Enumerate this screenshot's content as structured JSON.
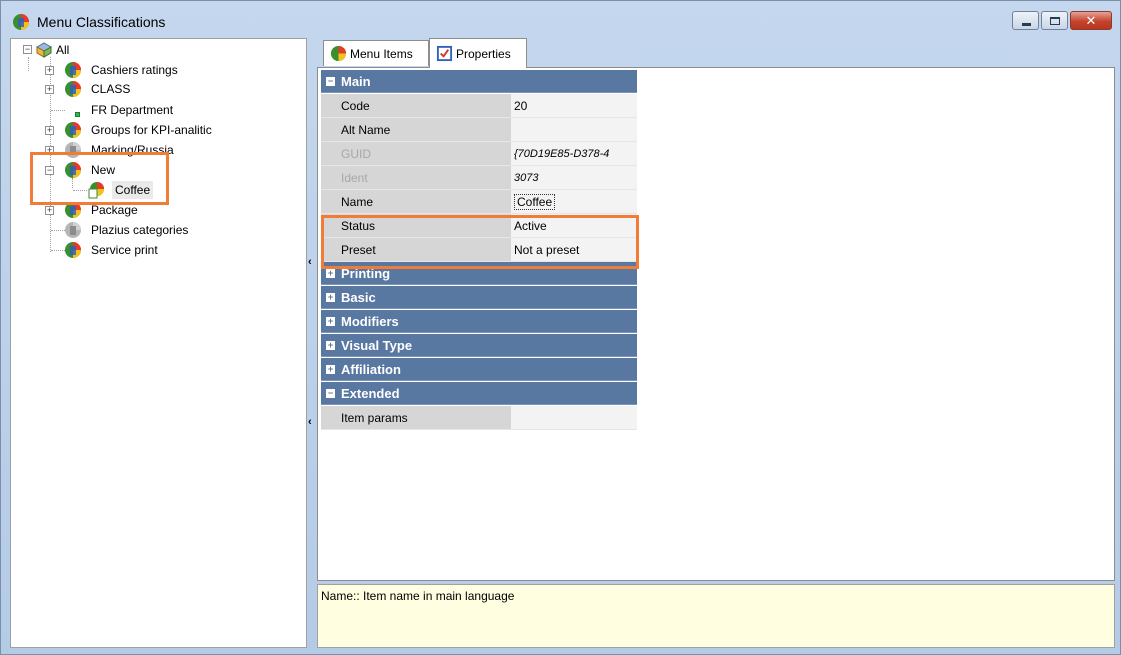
{
  "window": {
    "title": "Menu Classifications",
    "buttons": {
      "minimize": "minimize",
      "maximize": "maximize",
      "close": "✕"
    }
  },
  "tree": {
    "root": "All",
    "items": [
      {
        "label": "Cashiers ratings",
        "expander": "+"
      },
      {
        "label": "CLASS",
        "expander": "+"
      },
      {
        "label": "FR Department",
        "expander": ""
      },
      {
        "label": "Groups for KPI-analitic",
        "expander": "+"
      },
      {
        "label": "Marking/Russia",
        "expander": "+"
      },
      {
        "label": "New",
        "expander": "−"
      },
      {
        "label": "Coffee",
        "expander": ""
      },
      {
        "label": "Package",
        "expander": "+"
      },
      {
        "label": "Plazius categories",
        "expander": ""
      },
      {
        "label": "Service print",
        "expander": ""
      }
    ]
  },
  "tabs": [
    {
      "label": "Menu Items"
    },
    {
      "label": "Properties"
    }
  ],
  "properties": {
    "main": {
      "label": "Main",
      "rows": [
        {
          "name": "Code",
          "value": "20"
        },
        {
          "name": "Alt Name",
          "value": ""
        },
        {
          "name": "GUID",
          "value": "{70D19E85-D378-4"
        },
        {
          "name": "Ident",
          "value": "3073"
        },
        {
          "name": "Name",
          "value": "Coffee"
        },
        {
          "name": "Status",
          "value": "Active"
        },
        {
          "name": "Preset",
          "value": "Not a preset"
        }
      ]
    },
    "collapsed": [
      "Printing",
      "Basic",
      "Modifiers",
      "Visual Type",
      "Affiliation"
    ],
    "extended": {
      "label": "Extended",
      "rows": [
        {
          "name": "Item params",
          "value": ""
        }
      ]
    }
  },
  "description": "Name:: Item name in main language",
  "colors": {
    "category": "#5878a1",
    "highlight": "#f07c37",
    "description_bg": "#fffee0"
  }
}
